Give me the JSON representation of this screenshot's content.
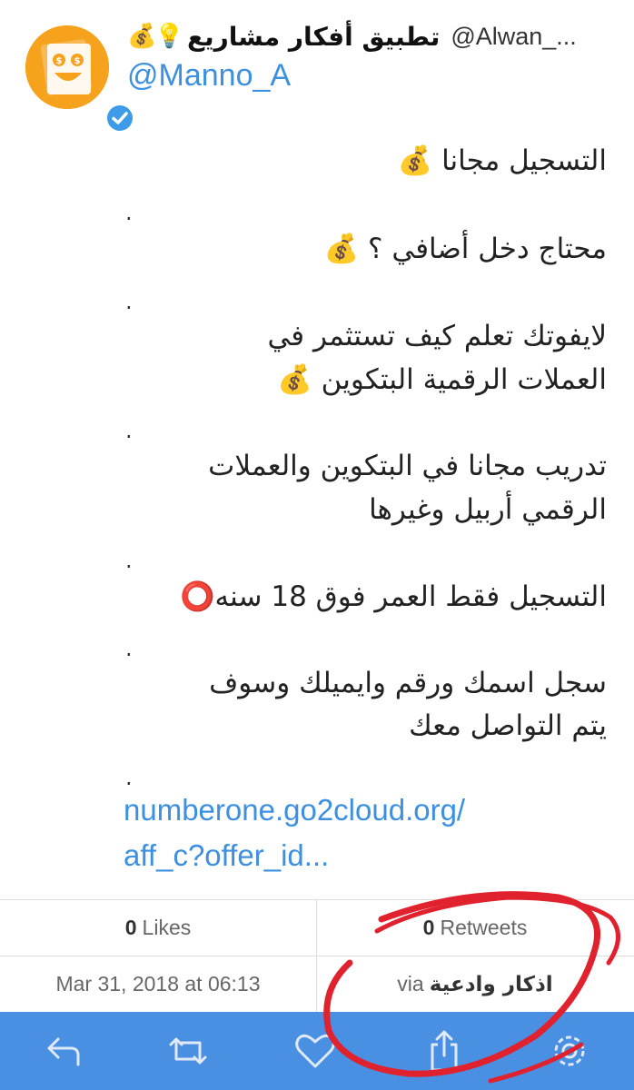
{
  "header": {
    "display_name": "تطبيق أفكار مشاريع",
    "alt_handle": "@Alwan_...",
    "handle": "@Manno_A",
    "emoji_bag": "💰",
    "emoji_bulb": "💡",
    "avatar_icon": "money-face-logo",
    "verified_icon": "verified-badge-icon"
  },
  "tweet": {
    "lines": [
      "التسجيل مجانا 💰",
      ".",
      "محتاج دخل أضافي ؟ 💰",
      ".",
      "لايفوتك تعلم كيف تستثمر في",
      "العملات الرقمية  البتكوين 💰",
      ".",
      "تدريب مجانا في البتكوين والعملات",
      "الرقمي أربيل وغيرها",
      ".",
      "التسجيل فقط العمر فوق 18 سنه⭕️",
      ".",
      "سجل اسمك ورقم وايميلك وسوف",
      "يتم التواصل معك",
      "."
    ],
    "link_line1": "numberone.go2cloud.org/",
    "link_line2": "aff_c?offer_id..."
  },
  "stats": {
    "likes_count": "0",
    "likes_label": "Likes",
    "retweets_count": "0",
    "retweets_label": "Retweets",
    "date": "Mar 31, 2018 at 06:13",
    "via_label": "via",
    "via_source": "اذكار  وادعية"
  },
  "toolbar": {
    "icons": [
      "reply-icon",
      "retweet-icon",
      "like-icon",
      "share-icon",
      "settings-icon"
    ],
    "background": "#4a90e2"
  },
  "colors": {
    "link": "#3d8fe0",
    "avatar": "#f6a21c",
    "annotation": "#e0222e"
  }
}
